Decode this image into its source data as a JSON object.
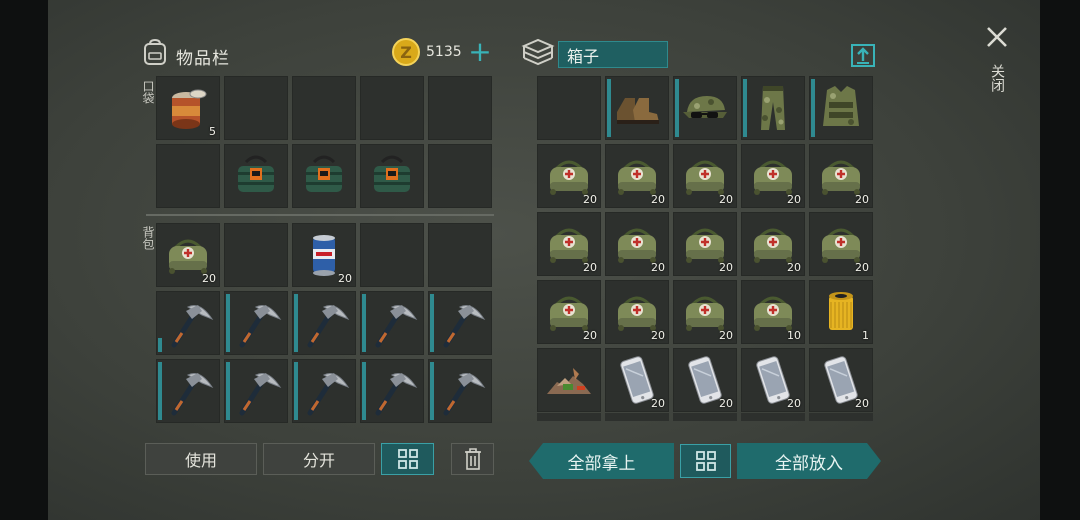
{
  "inventory": {
    "title": "物品栏",
    "coins": "5135",
    "pocket_label": "口袋",
    "backpack_label": "背包",
    "pocket_slots": [
      {
        "item": "canned-food",
        "count": "5",
        "eq": false
      },
      {
        "item": "",
        "count": "",
        "eq": false
      },
      {
        "item": "",
        "count": "",
        "eq": false
      },
      {
        "item": "",
        "count": "",
        "eq": false
      },
      {
        "item": "",
        "count": "",
        "eq": false
      },
      {
        "item": "",
        "count": "",
        "eq": false
      },
      {
        "item": "dynamite-bundle",
        "count": "",
        "eq": false
      },
      {
        "item": "dynamite-bundle",
        "count": "",
        "eq": false
      },
      {
        "item": "dynamite-bundle",
        "count": "",
        "eq": false
      },
      {
        "item": "",
        "count": "",
        "eq": false
      }
    ],
    "backpack_slots": [
      {
        "item": "medkit-bag",
        "count": "20",
        "eq": false
      },
      {
        "item": "",
        "count": "",
        "eq": false
      },
      {
        "item": "soda-can",
        "count": "20",
        "eq": false
      },
      {
        "item": "",
        "count": "",
        "eq": false
      },
      {
        "item": "",
        "count": "",
        "eq": false
      },
      {
        "item": "pickaxe",
        "count": "",
        "eq": "dur"
      },
      {
        "item": "pickaxe",
        "count": "",
        "eq": true
      },
      {
        "item": "pickaxe",
        "count": "",
        "eq": true
      },
      {
        "item": "pickaxe",
        "count": "",
        "eq": true
      },
      {
        "item": "pickaxe",
        "count": "",
        "eq": true
      },
      {
        "item": "pickaxe",
        "count": "",
        "eq": true
      },
      {
        "item": "pickaxe",
        "count": "",
        "eq": true
      },
      {
        "item": "pickaxe",
        "count": "",
        "eq": true
      },
      {
        "item": "pickaxe",
        "count": "",
        "eq": true
      },
      {
        "item": "pickaxe",
        "count": "",
        "eq": true
      }
    ],
    "buttons": {
      "use": "使用",
      "split": "分开"
    }
  },
  "box": {
    "name": "箱子",
    "slots": [
      {
        "item": "",
        "count": "",
        "eq": false
      },
      {
        "item": "boots",
        "count": "",
        "eq": true
      },
      {
        "item": "camo-cap-sunglasses",
        "count": "",
        "eq": true
      },
      {
        "item": "camo-pants",
        "count": "",
        "eq": true
      },
      {
        "item": "camo-vest",
        "count": "",
        "eq": true
      },
      {
        "item": "medkit-bag",
        "count": "20",
        "eq": false
      },
      {
        "item": "medkit-bag",
        "count": "20",
        "eq": false
      },
      {
        "item": "medkit-bag",
        "count": "20",
        "eq": false
      },
      {
        "item": "medkit-bag",
        "count": "20",
        "eq": false
      },
      {
        "item": "medkit-bag",
        "count": "20",
        "eq": false
      },
      {
        "item": "medkit-bag",
        "count": "20",
        "eq": false
      },
      {
        "item": "medkit-bag",
        "count": "20",
        "eq": false
      },
      {
        "item": "medkit-bag",
        "count": "20",
        "eq": false
      },
      {
        "item": "medkit-bag",
        "count": "20",
        "eq": false
      },
      {
        "item": "medkit-bag",
        "count": "20",
        "eq": false
      },
      {
        "item": "medkit-bag",
        "count": "20",
        "eq": false
      },
      {
        "item": "medkit-bag",
        "count": "20",
        "eq": false
      },
      {
        "item": "medkit-bag",
        "count": "20",
        "eq": false
      },
      {
        "item": "medkit-bag",
        "count": "10",
        "eq": false
      },
      {
        "item": "oil-filter",
        "count": "1",
        "eq": false
      },
      {
        "item": "scrap-pile",
        "count": "",
        "eq": false
      },
      {
        "item": "smartphone",
        "count": "20",
        "eq": false
      },
      {
        "item": "smartphone",
        "count": "20",
        "eq": false
      },
      {
        "item": "smartphone",
        "count": "20",
        "eq": false
      },
      {
        "item": "smartphone",
        "count": "20",
        "eq": false
      }
    ],
    "buttons": {
      "take_all": "全部拿上",
      "put_all": "全部放入"
    }
  },
  "close_label": "关闭",
  "colors": {
    "teal": "#2f8a90",
    "bg": "#3d413b",
    "slot": "#2d302d",
    "coin": "#e0b020"
  }
}
